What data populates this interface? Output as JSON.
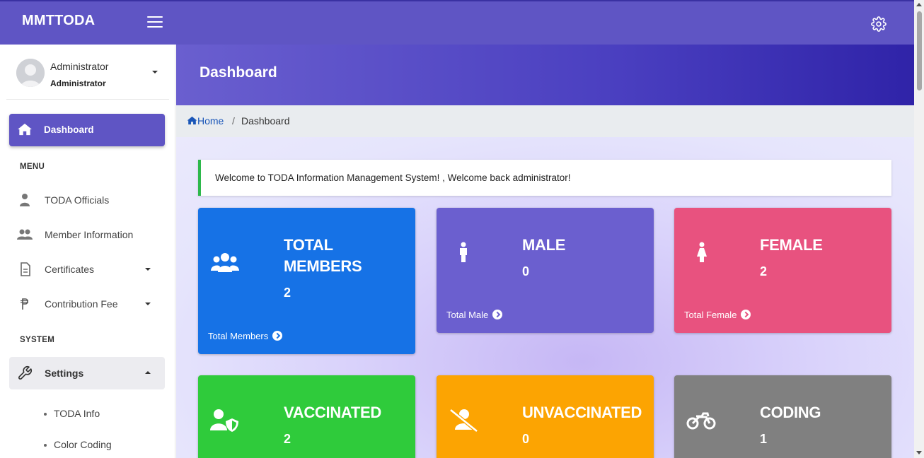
{
  "brand": "MMTTODA",
  "user": {
    "name": "Administrator",
    "role": "Administrator"
  },
  "sidebar": {
    "active": "Dashboard",
    "menu_header": "MENU",
    "items": [
      {
        "label": "TODA Officials",
        "icon": "officials-icon"
      },
      {
        "label": "Member Information",
        "icon": "members-icon"
      },
      {
        "label": "Certificates",
        "icon": "certificate-icon"
      },
      {
        "label": "Contribution Fee",
        "icon": "peso-icon"
      }
    ],
    "system_header": "SYSTEM",
    "settings": "Settings",
    "sub_items": [
      "TODA Info",
      "Color Coding"
    ]
  },
  "page_title": "Dashboard",
  "breadcrumb": {
    "home": "Home",
    "separator": "/",
    "current": "Dashboard"
  },
  "welcome": "Welcome to TODA Information Management System! , Welcome back administrator!",
  "cards": {
    "total": {
      "title_line1": "TOTAL",
      "title_line2": "MEMBERS",
      "value": "2",
      "link": "Total Members",
      "color": "#1672e6"
    },
    "male": {
      "title": "MALE",
      "value": "0",
      "link": "Total Male",
      "color": "#6b5fcf"
    },
    "female": {
      "title": "FEMALE",
      "value": "2",
      "link": "Total Female",
      "color": "#e8527f"
    },
    "vaccinated": {
      "title": "VACCINATED",
      "value": "2",
      "color": "#2fcb3b"
    },
    "unvaccinated": {
      "title": "UNVACCINATED",
      "value": "0",
      "color": "#fca402"
    },
    "coding": {
      "title": "CODING",
      "value": "1",
      "color": "#808080"
    }
  }
}
